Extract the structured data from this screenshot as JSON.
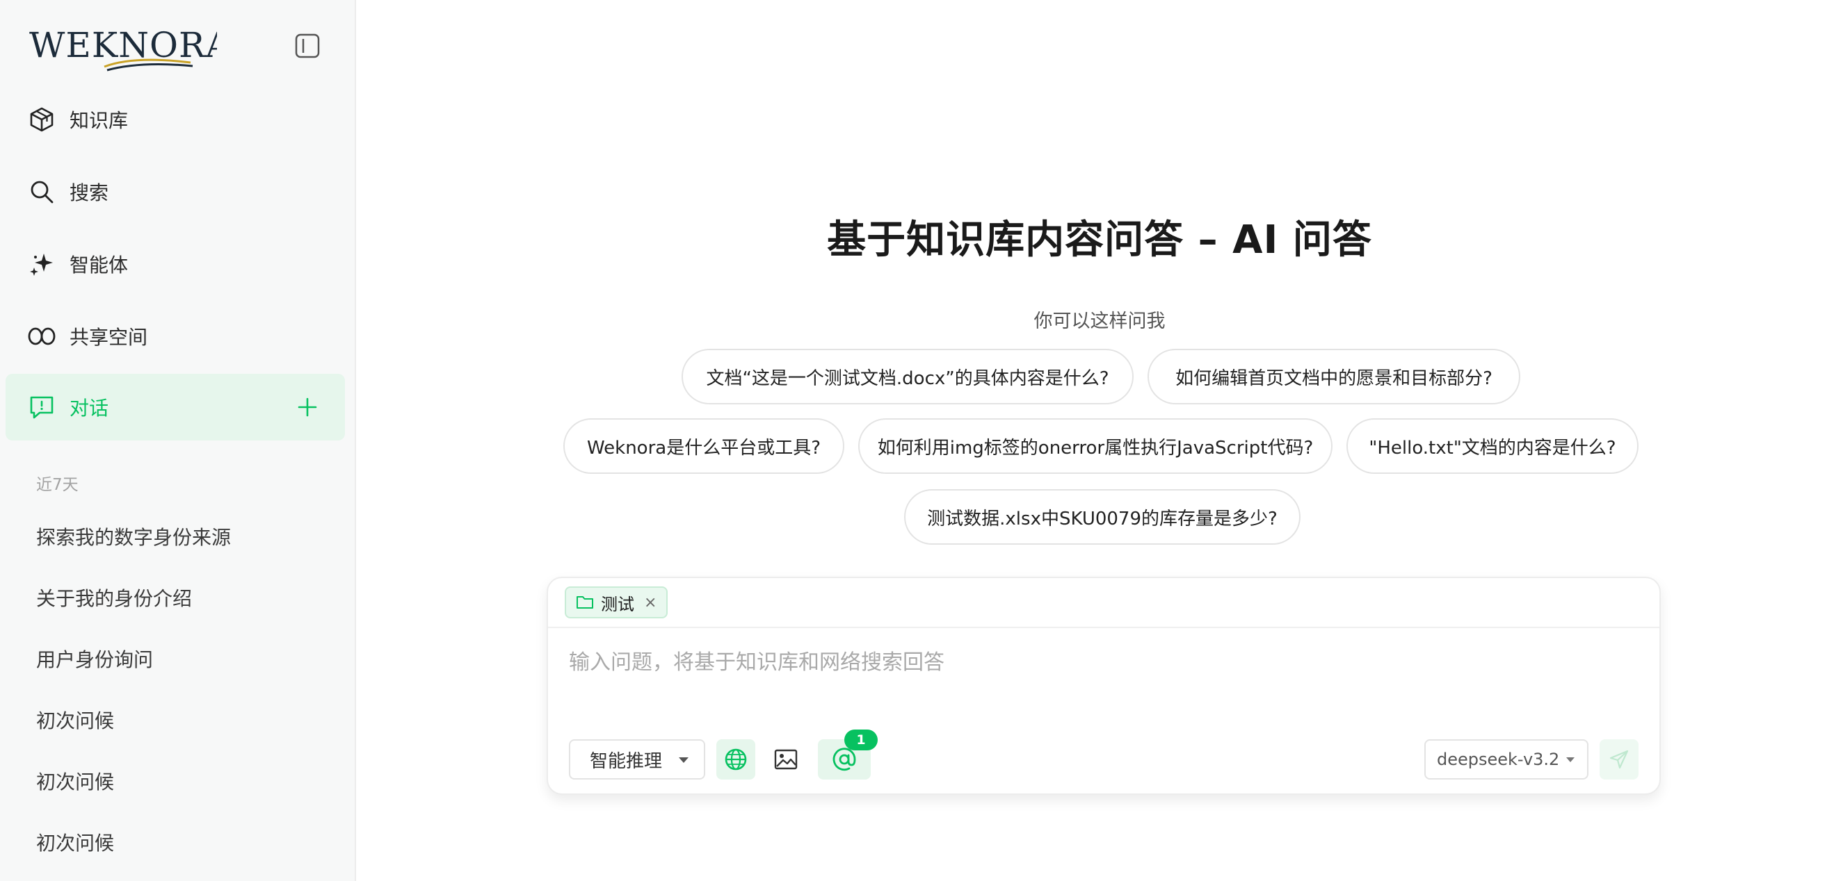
{
  "brand": {
    "logo_text": "WEKNORA"
  },
  "sidebar": {
    "nav": [
      {
        "label": "知识库",
        "icon": "cube-icon"
      },
      {
        "label": "搜索",
        "icon": "search-icon"
      },
      {
        "label": "智能体",
        "icon": "sparkle-icon"
      },
      {
        "label": "共享空间",
        "icon": "infinity-icon"
      },
      {
        "label": "对话",
        "icon": "chat-icon",
        "active": true
      }
    ],
    "section_label": "近7天",
    "history": [
      "探索我的数字身份来源",
      "关于我的身份介绍",
      "用户身份询问",
      "初次问候",
      "初次问候",
      "初次问候"
    ]
  },
  "main": {
    "title": "基于知识库内容问答 – AI 问答",
    "subtitle": "你可以这样问我",
    "suggestions": [
      "文档“这是一个测试文档.docx”的具体内容是什么?",
      "如何编辑首页文档中的愿景和目标部分?",
      "Weknora是什么平台或工具?",
      "如何利用img标签的onerror属性执行JavaScript代码?",
      "\"Hello.txt\"文档的内容是什么?",
      "测试数据.xlsx中SKU0079的库存量是多少?"
    ],
    "input": {
      "kb_tag": "测试",
      "kb_tag_close": "×",
      "placeholder": "输入问题，将基于知识库和网络搜索回答",
      "value": "",
      "mode": "智能推理",
      "mention_count": "1",
      "model": "deepseek-v3.2"
    }
  },
  "colors": {
    "accent": "#07c160",
    "accent_bg": "#e6f6ec"
  }
}
